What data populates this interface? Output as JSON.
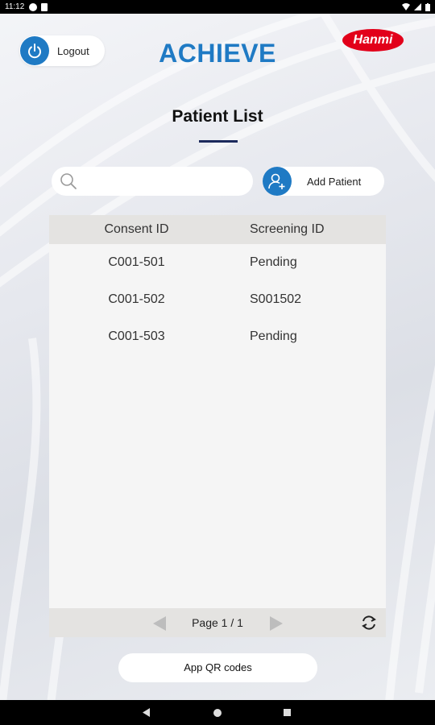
{
  "status_bar": {
    "time": "11:12"
  },
  "header": {
    "logout_label": "Logout",
    "app_title": "ACHIEVE",
    "brand": "Hanmi"
  },
  "page": {
    "title": "Patient List"
  },
  "search": {
    "value": "",
    "placeholder": ""
  },
  "add_patient": {
    "label": "Add Patient"
  },
  "table": {
    "columns": [
      "Consent ID",
      "Screening ID"
    ],
    "rows": [
      {
        "consent_id": "C001-501",
        "screening_id": "Pending"
      },
      {
        "consent_id": "C001-502",
        "screening_id": "S001502"
      },
      {
        "consent_id": "C001-503",
        "screening_id": "Pending"
      }
    ]
  },
  "pagination": {
    "label": "Page 1 / 1"
  },
  "footer": {
    "qr_label": "App QR codes"
  },
  "colors": {
    "accent": "#1f7ac4",
    "brand_red": "#e2001a",
    "underline": "#1c2a5c"
  },
  "icons": [
    "power-icon",
    "search-icon",
    "add-user-icon",
    "prev-arrow-icon",
    "next-arrow-icon",
    "refresh-icon"
  ]
}
